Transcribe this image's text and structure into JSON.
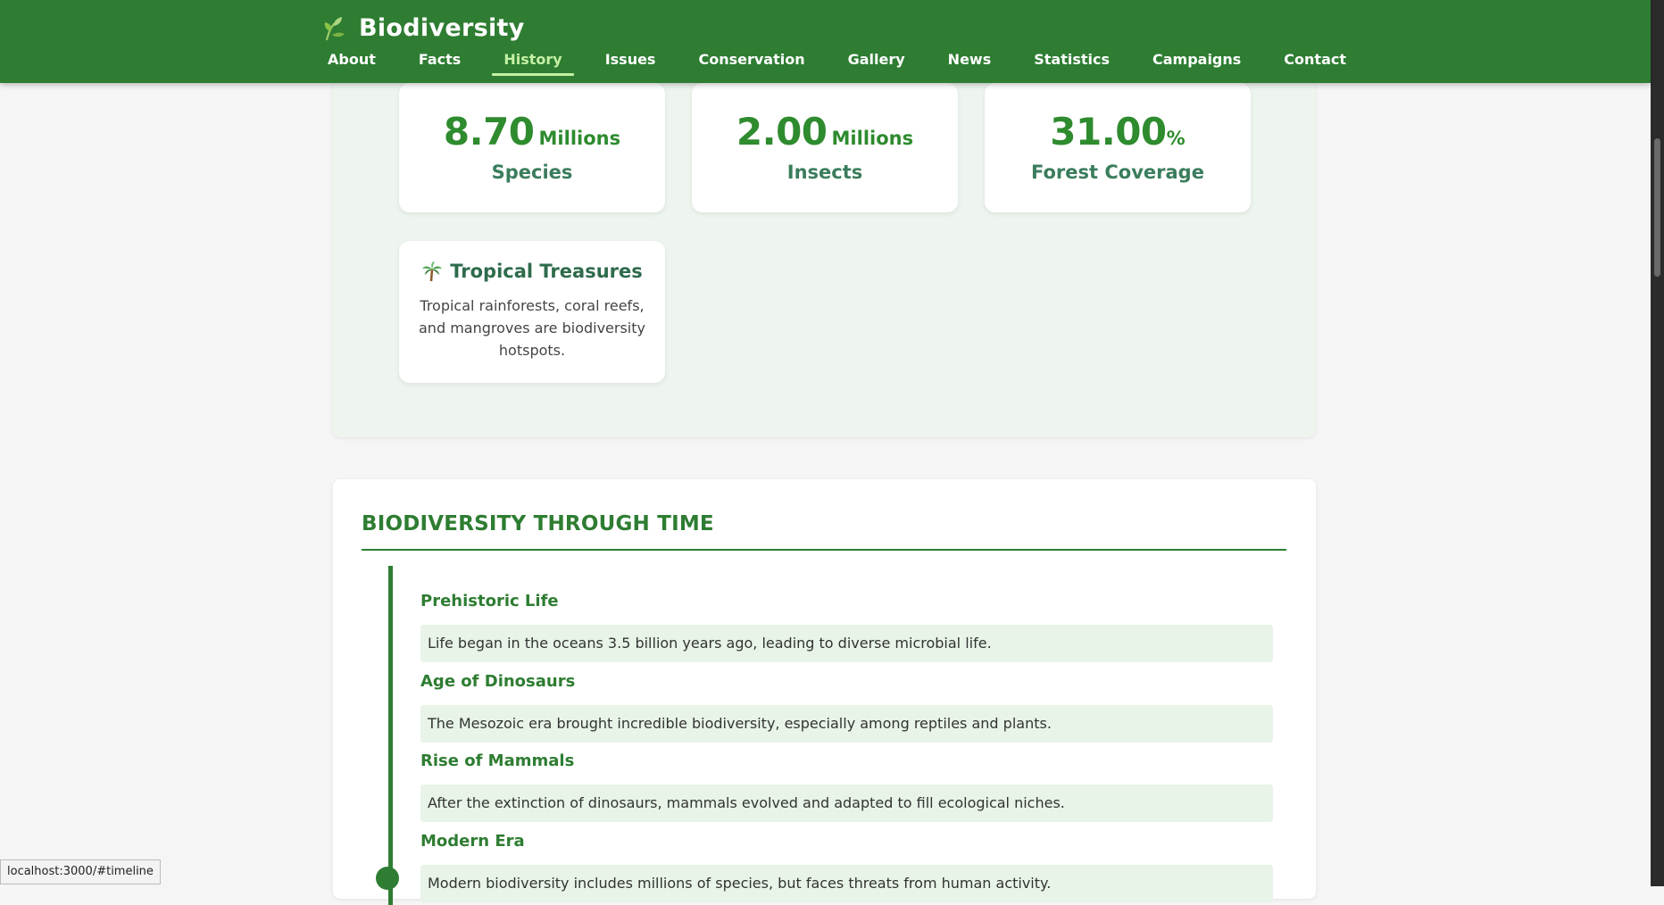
{
  "header": {
    "brand": "Biodiversity",
    "nav": [
      "About",
      "Facts",
      "History",
      "Issues",
      "Conservation",
      "Gallery",
      "News",
      "Statistics",
      "Campaigns",
      "Contact"
    ],
    "active_nav": "History"
  },
  "facts": {
    "stats": [
      {
        "value": "8.70",
        "unit": "Millions",
        "label": "Species"
      },
      {
        "value": "2.00",
        "unit": "Millions",
        "label": "Insects"
      },
      {
        "value": "31.00",
        "unit": "%",
        "label": "Forest Coverage"
      }
    ],
    "info_card": {
      "icon": "palm-tree-icon",
      "title": "Tropical Treasures",
      "text": "Tropical rainforests, coral reefs, and mangroves are biodiversity hotspots."
    }
  },
  "timeline": {
    "title": "BIODIVERSITY THROUGH TIME",
    "events": [
      {
        "title": "Prehistoric Life",
        "text": "Life began in the oceans 3.5 billion years ago, leading to diverse microbial life."
      },
      {
        "title": "Age of Dinosaurs",
        "text": "The Mesozoic era brought incredible biodiversity, especially among reptiles and plants."
      },
      {
        "title": "Rise of Mammals",
        "text": "After the extinction of dinosaurs, mammals evolved and adapted to fill ecological niches."
      },
      {
        "title": "Modern Era",
        "text": "Modern biodiversity includes millions of species, but faces threats from human activity."
      }
    ]
  },
  "status_url": "localhost:3000/#timeline",
  "colors": {
    "primary": "#2e7d32",
    "accent": "#c5f0a4",
    "panel": "#eef5ef",
    "highlight": "#e7f4e7"
  }
}
